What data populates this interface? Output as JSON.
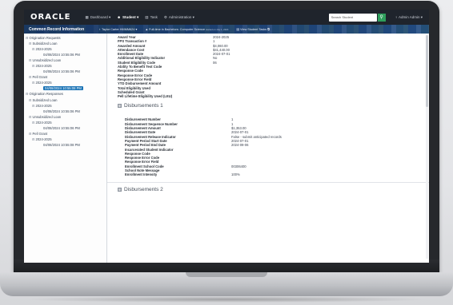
{
  "navbar": {
    "logo": "ORACLE",
    "items": [
      {
        "icon": "dashboard-icon",
        "label": "Dashboard ▾",
        "active": false
      },
      {
        "icon": "student-icon",
        "label": "Student ▾",
        "active": true
      },
      {
        "icon": "task-icon",
        "label": "Task",
        "active": false
      },
      {
        "icon": "gear-icon",
        "label": "Administration ▾",
        "active": false
      }
    ],
    "search": {
      "value": "Search Student",
      "button_icon": "search-icon"
    },
    "user": "♀ Admin Admin ▾"
  },
  "banner": {
    "title": "Common Record Information",
    "student": "♀ Taylor Carter HMMM624 ▾",
    "enrollment": "Full-time in Bachelors: Computer Science",
    "enrollment_since": "started on July 1, 2024",
    "view_tasks": "View Student Tasks ⧉"
  },
  "sidebar": {
    "items": [
      {
        "level": 1,
        "toggle": "⊟",
        "label": "Origination Requests",
        "selected": false
      },
      {
        "level": 2,
        "toggle": "⊟",
        "label": "Subsidized Loan",
        "selected": false
      },
      {
        "level": 3,
        "toggle": "⊟",
        "label": "2024-2025",
        "selected": false
      },
      {
        "level": 4,
        "toggle": "",
        "label": "04/08/2024 10:55:06 PM",
        "selected": false
      },
      {
        "level": 2,
        "toggle": "⊟",
        "label": "Unsubsidized Loan",
        "selected": false
      },
      {
        "level": 3,
        "toggle": "⊟",
        "label": "2024-2025",
        "selected": false
      },
      {
        "level": 4,
        "toggle": "",
        "label": "04/08/2024 10:55:06 PM",
        "selected": false
      },
      {
        "level": 2,
        "toggle": "⊟",
        "label": "Pell Grant",
        "selected": false
      },
      {
        "level": 3,
        "toggle": "⊟",
        "label": "2024-2025",
        "selected": false
      },
      {
        "level": 4,
        "toggle": "",
        "label": "04/08/2024 10:55:08 PM",
        "selected": true
      },
      {
        "level": 1,
        "toggle": "⊟",
        "label": "Origination Responses",
        "selected": false
      },
      {
        "level": 2,
        "toggle": "⊟",
        "label": "Subsidized Loan",
        "selected": false
      },
      {
        "level": 3,
        "toggle": "⊟",
        "label": "2024-2025",
        "selected": false
      },
      {
        "level": 4,
        "toggle": "",
        "label": "04/08/2024 10:55:06 PM",
        "selected": false
      },
      {
        "level": 2,
        "toggle": "⊟",
        "label": "Unsubsidized Loan",
        "selected": false
      },
      {
        "level": 3,
        "toggle": "⊟",
        "label": "2024-2025",
        "selected": false
      },
      {
        "level": 4,
        "toggle": "",
        "label": "04/08/2024 10:55:06 PM",
        "selected": false
      },
      {
        "level": 2,
        "toggle": "⊟",
        "label": "Pell Grant",
        "selected": false
      },
      {
        "level": 3,
        "toggle": "⊟",
        "label": "2024-2025",
        "selected": false
      },
      {
        "level": 4,
        "toggle": "",
        "label": "04/08/2024 10:55:08 PM",
        "selected": false
      }
    ]
  },
  "award_fields": [
    {
      "label": "Award Year",
      "value": "2024-2025"
    },
    {
      "label": "FPS Transaction #",
      "value": "1"
    },
    {
      "label": "Awarded Amount",
      "value": "$4,060.00"
    },
    {
      "label": "Attendance Cost",
      "value": "$41,440.00"
    },
    {
      "label": "Enrollment Date",
      "value": "2024-07-01"
    },
    {
      "label": "Additional Eligibility Indicator",
      "value": "No"
    },
    {
      "label": "Student Eligibility Code",
      "value": "06"
    },
    {
      "label": "Ability To Benefit Test Code",
      "value": ""
    },
    {
      "label": "Response Code",
      "value": ""
    },
    {
      "label": "Response Error Code",
      "value": ""
    },
    {
      "label": "Response Error Field",
      "value": ""
    },
    {
      "label": "YTD Disbursement Amount",
      "value": ""
    },
    {
      "label": "Total Eligibility Used",
      "value": ""
    },
    {
      "label": "Scheduled Grant",
      "value": ""
    },
    {
      "label": "Pell Lifetime Eligibility Used (LEU)",
      "value": ""
    }
  ],
  "disbursements": [
    {
      "title": "Disbursements 1",
      "toggle": "⊟",
      "fields": [
        {
          "label": "Disbursement Number",
          "value": "1"
        },
        {
          "label": "Disbursement Sequence Number",
          "value": "1"
        },
        {
          "label": "Disbursement Amount",
          "value": "$1,353.00"
        },
        {
          "label": "Disbursement Date",
          "value": "2024-07-01"
        },
        {
          "label": "Disbursement Release Indicator",
          "value": "False - submit anticipated records"
        },
        {
          "label": "Payment Period Start Date",
          "value": "2024-07-01"
        },
        {
          "label": "Payment Period End Date",
          "value": "2024-09-06"
        },
        {
          "label": "Incarcerated Student Indicator",
          "value": ""
        },
        {
          "label": "Response Code",
          "value": ""
        },
        {
          "label": "Response Error Code",
          "value": ""
        },
        {
          "label": "Response Error Field",
          "value": ""
        },
        {
          "label": "Enrollment School Code",
          "value": "00306400"
        },
        {
          "label": "School Note Message",
          "value": ""
        },
        {
          "label": "Enrollment Intensity",
          "value": "100%"
        }
      ]
    },
    {
      "title": "Disbursements 2",
      "toggle": "⊟",
      "fields": []
    }
  ]
}
